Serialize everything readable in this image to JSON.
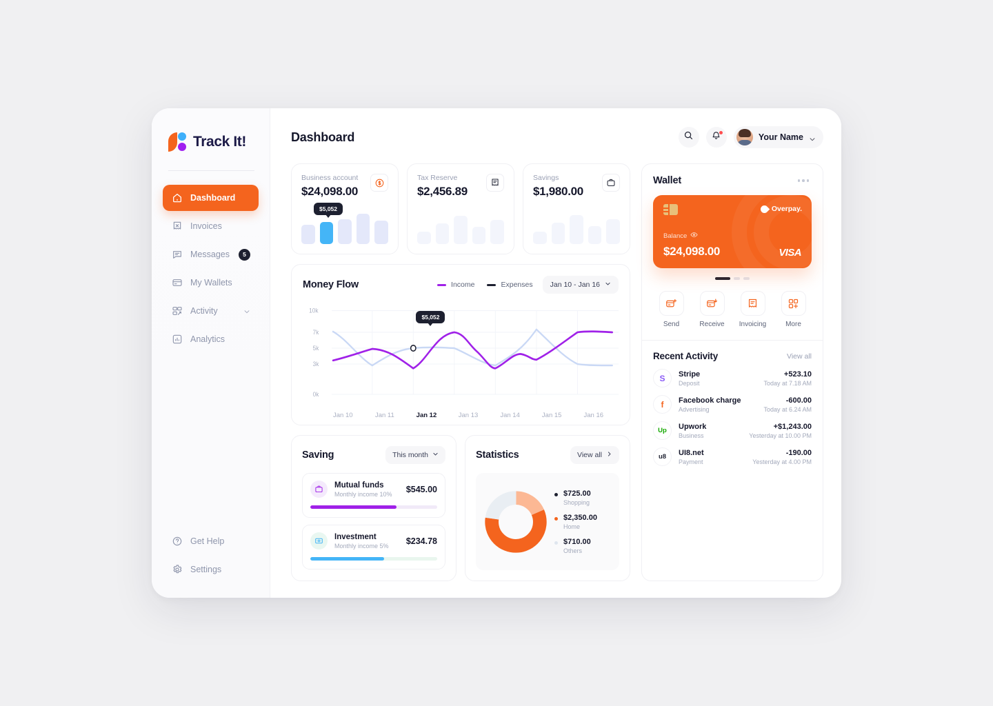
{
  "brand": {
    "name": "Track It!",
    "accent": "#f4641e"
  },
  "sidebar": {
    "items": [
      {
        "label": "Dashboard",
        "icon": "home-icon",
        "active": true
      },
      {
        "label": "Invoices",
        "icon": "invoice-icon",
        "active": false
      },
      {
        "label": "Messages",
        "icon": "message-icon",
        "badge": "5",
        "active": false
      },
      {
        "label": "My Wallets",
        "icon": "wallet-icon",
        "active": false
      },
      {
        "label": "Activity",
        "icon": "activity-icon",
        "chevron": true,
        "active": false
      },
      {
        "label": "Analytics",
        "icon": "analytics-icon",
        "active": false
      }
    ],
    "bottom": [
      {
        "label": "Get Help",
        "icon": "help-icon"
      },
      {
        "label": "Settings",
        "icon": "gear-icon"
      }
    ]
  },
  "header": {
    "title": "Dashboard",
    "search_icon": "search-icon",
    "bell_icon": "bell-icon",
    "profile_name": "Your Name"
  },
  "stat_cards": [
    {
      "label": "Business account",
      "value": "$24,098.00",
      "icon": "dollar-coin-icon",
      "tooltip": "$5,052",
      "highlight": true
    },
    {
      "label": "Tax Reserve",
      "value": "$2,456.89",
      "icon": "receipt-icon",
      "highlight": false
    },
    {
      "label": "Savings",
      "value": "$1,980.00",
      "icon": "briefcase-icon",
      "highlight": false
    }
  ],
  "money_flow": {
    "title": "Money Flow",
    "legend": [
      {
        "label": "Income",
        "color": "#a021e8"
      },
      {
        "label": "Expenses",
        "color": "#1d2030"
      }
    ],
    "range": "Jan 10 - Jan 16",
    "tooltip": "$5,052"
  },
  "chart_data": {
    "type": "line",
    "title": "Money Flow",
    "xlabel": "",
    "ylabel": "",
    "ylim": [
      0,
      10000
    ],
    "ytick_labels": [
      "10k",
      "7k",
      "5k",
      "3k",
      "0k"
    ],
    "yticks": [
      10000,
      7000,
      5000,
      3000,
      0
    ],
    "grid": true,
    "legend_position": "top-right",
    "categories": [
      "Jan 10",
      "Jan 11",
      "Jan 12",
      "Jan 13",
      "Jan 14",
      "Jan 15",
      "Jan 16"
    ],
    "highlighted_category": "Jan 12",
    "highlighted_value": 5052,
    "series": [
      {
        "name": "Income",
        "color": "#a021e8",
        "values": [
          3500,
          4700,
          2600,
          7000,
          2600,
          3900,
          7000
        ]
      },
      {
        "name": "Expenses",
        "color": "#c9d8f5",
        "values": [
          6600,
          2900,
          5052,
          2900,
          4600,
          7200,
          2900
        ]
      }
    ]
  },
  "saving": {
    "title": "Saving",
    "period": "This month",
    "items": [
      {
        "name": "Mutual funds",
        "sub": "Monthly income 10%",
        "amount": "$545.00",
        "progress": 68,
        "color": "#a021e8",
        "track": "#f1eaf8",
        "icon": "briefcase-icon"
      },
      {
        "name": "Investment",
        "sub": "Monthly income 5%",
        "amount": "$234.78",
        "progress": 58,
        "color": "#44b5f7",
        "track": "#e9f6ee",
        "icon": "money-icon"
      }
    ]
  },
  "statistics": {
    "title": "Statistics",
    "view_all": "View all",
    "donut": {
      "type": "pie",
      "title": "Statistics",
      "labels": [
        "Shopping",
        "Home",
        "Others"
      ],
      "values": [
        725.0,
        2350.0,
        710.0
      ],
      "display_values": [
        "$725.00",
        "$2,350.00",
        "$710.00"
      ],
      "colors": [
        "#fcb894",
        "#f4641e",
        "#e9eef3"
      ],
      "dot_colors": [
        "#1d2030",
        "#f4641e",
        "#dfe6ee"
      ]
    }
  },
  "wallet": {
    "title": "Wallet",
    "menu_icon": "more-horizontal-icon",
    "card": {
      "brand": "Overpay.",
      "balance_label": "Balance",
      "balance_value": "$24,098.00",
      "network": "VISA",
      "eye_icon": "eye-icon",
      "chip_icon": "chip-icon",
      "color": "#f4641e"
    },
    "carousel": {
      "count": 4,
      "active": 0
    },
    "actions": [
      {
        "label": "Send",
        "icon": "send-card-icon"
      },
      {
        "label": "Receive",
        "icon": "receive-card-icon"
      },
      {
        "label": "Invoicing",
        "icon": "invoice-icon"
      },
      {
        "label": "More",
        "icon": "grid-plus-icon"
      }
    ]
  },
  "recent_activity": {
    "title": "Recent Activity",
    "view_all": "View all",
    "items": [
      {
        "name": "Stripe",
        "sub": "Deposit",
        "amount": "+523.10",
        "time": "Today at 7.18 AM",
        "icon": "stripe-icon",
        "icon_color": "#8b5cf6",
        "glyph": "S"
      },
      {
        "name": "Facebook charge",
        "sub": "Advertising",
        "amount": "-600.00",
        "time": "Today at 6.24 AM",
        "icon": "facebook-icon",
        "icon_color": "#f4641e",
        "glyph": "f"
      },
      {
        "name": "Upwork",
        "sub": "Business",
        "amount": "+$1,243.00",
        "time": "Yesterday at 10.00 PM",
        "icon": "upwork-icon",
        "icon_color": "#14a800",
        "glyph": "Up"
      },
      {
        "name": "UI8.net",
        "sub": "Payment",
        "amount": "-190.00",
        "time": "Yesterday at 4.00 PM",
        "icon": "ui8-icon",
        "icon_color": "#1d2030",
        "glyph": "u8"
      }
    ]
  }
}
